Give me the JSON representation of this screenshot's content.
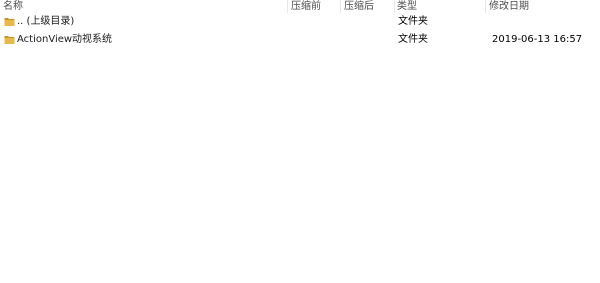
{
  "columns": {
    "name": "名称",
    "before": "压缩前",
    "after": "压缩后",
    "type": "类型",
    "modified": "修改日期"
  },
  "rows": [
    {
      "icon": "folder-icon",
      "name": ".. (上级目录)",
      "before": "",
      "after": "",
      "type": "文件夹",
      "modified": ""
    },
    {
      "icon": "folder-icon",
      "name": "ActionView动视系统",
      "before": "",
      "after": "",
      "type": "文件夹",
      "modified": "2019-06-13 16:57"
    }
  ],
  "colors": {
    "folder": "#e8b84a",
    "folder_dark": "#c9932a",
    "header_text": "#4d4d4d"
  }
}
